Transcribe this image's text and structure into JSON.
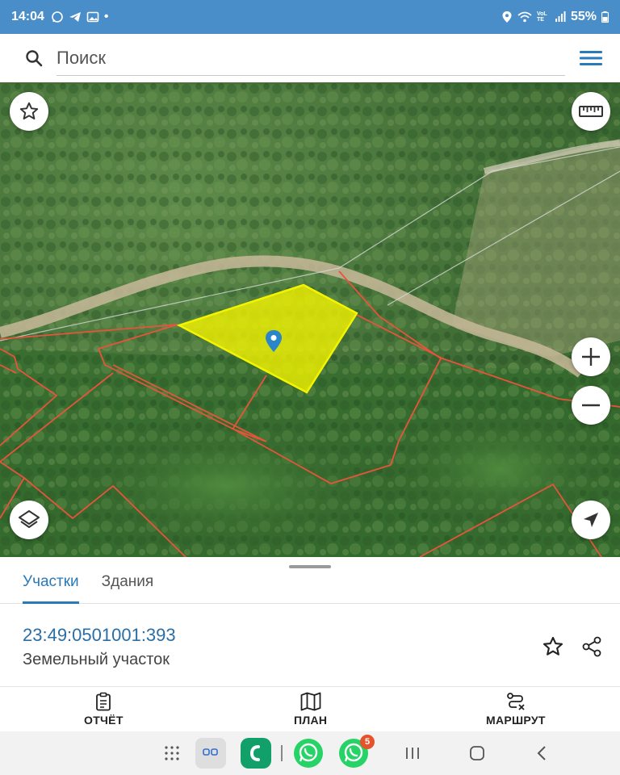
{
  "status_bar": {
    "time": "14:04",
    "battery": "55%",
    "network": "VoLTE"
  },
  "search": {
    "placeholder": "Поиск"
  },
  "map": {
    "layer": "satellite",
    "colors": {
      "selected_fill": "#f2f200",
      "parcel_border": "#e8543a",
      "marker": "#2a86c8"
    }
  },
  "sheet": {
    "tabs": [
      {
        "label": "Участки",
        "active": true
      },
      {
        "label": "Здания",
        "active": false
      }
    ],
    "parcel": {
      "cadastral_number": "23:49:0501001:393",
      "type": "Земельный участок"
    }
  },
  "bottom_nav": {
    "items": [
      {
        "label": "ОТЧЁТ",
        "icon": "clipboard-icon"
      },
      {
        "label": "ПЛАН",
        "icon": "map-icon"
      },
      {
        "label": "МАРШРУТ",
        "icon": "route-icon"
      }
    ]
  },
  "android_nav": {
    "whatsapp_badge": "5"
  },
  "colors": {
    "accent": "#2a7ab8",
    "status_bar": "#4a8ec9"
  }
}
